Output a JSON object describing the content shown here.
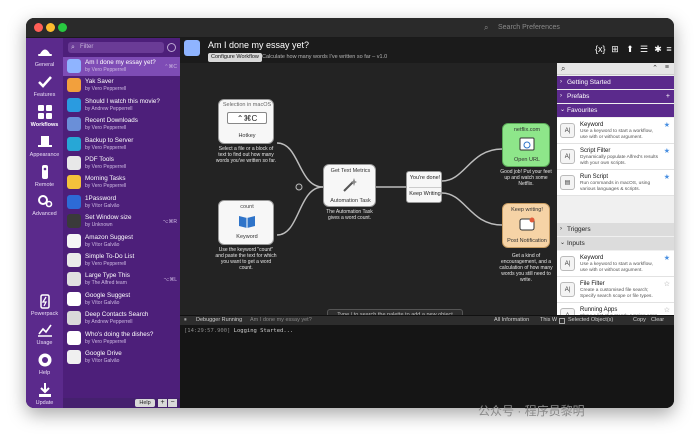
{
  "window": {
    "search_placeholder": "Search Preferences"
  },
  "rail": {
    "items": [
      {
        "label": "General",
        "icon": "alfred-hat-icon"
      },
      {
        "label": "Features",
        "icon": "checkmark-icon"
      },
      {
        "label": "Workflows",
        "icon": "grid-icon"
      },
      {
        "label": "Appearance",
        "icon": "top-hat-icon"
      },
      {
        "label": "Remote",
        "icon": "remote-icon"
      },
      {
        "label": "Advanced",
        "icon": "gears-icon"
      },
      {
        "label": "Powerpack",
        "icon": "battery-icon"
      },
      {
        "label": "Usage",
        "icon": "chart-icon"
      },
      {
        "label": "Help",
        "icon": "lifebuoy-icon"
      },
      {
        "label": "Update",
        "icon": "download-icon"
      }
    ]
  },
  "workflows": {
    "filter_placeholder": "Filter",
    "items": [
      {
        "name": "Am I done my essay yet?",
        "by": "by Vero Pepperrell",
        "hotkey": "⌃⌘C",
        "color": "#8fb4ff"
      },
      {
        "name": "Yak Saver",
        "by": "by Vero Pepperrell",
        "hotkey": "",
        "color": "#f2a03d"
      },
      {
        "name": "Should I watch this movie?",
        "by": "by Andrew Pepperrell",
        "hotkey": "",
        "color": "#2a9be0"
      },
      {
        "name": "Recent Downloads",
        "by": "by Vero Pepperrell",
        "hotkey": "",
        "color": "#6a8fd8"
      },
      {
        "name": "Backup to Server",
        "by": "by Vero Pepperrell",
        "hotkey": "",
        "color": "#27a7d6"
      },
      {
        "name": "PDF Tools",
        "by": "by Vero Pepperrell",
        "hotkey": "",
        "color": "#e8e8e8"
      },
      {
        "name": "Morning Tasks",
        "by": "by Vero Pepperrell",
        "hotkey": "",
        "color": "#f3c23b"
      },
      {
        "name": "1Password",
        "by": "by Vítor Galvão",
        "hotkey": "",
        "color": "#2d6bd6"
      },
      {
        "name": "Set Window size",
        "by": "by Unknown",
        "hotkey": "⌥⌘R",
        "color": "#3a3a3a"
      },
      {
        "name": "Amazon Suggest",
        "by": "by Vítor Galvão",
        "hotkey": "",
        "color": "#f5f5f5"
      },
      {
        "name": "Simple To-Do List",
        "by": "by Vero Pepperrell",
        "hotkey": "",
        "color": "#eaeaea"
      },
      {
        "name": "Large Type This",
        "by": "by The Alfred team",
        "hotkey": "⌥⌘L",
        "color": "#e0e0e0"
      },
      {
        "name": "Google Suggest",
        "by": "by Vítor Galvão",
        "hotkey": "",
        "color": "#ffffff"
      },
      {
        "name": "Deep Contacts Search",
        "by": "by Andrew Pepperrell",
        "hotkey": "",
        "color": "#d9d9d9"
      },
      {
        "name": "Who's doing the dishes?",
        "by": "by Vero Pepperrell",
        "hotkey": "",
        "color": "#ffffff"
      },
      {
        "name": "Google Drive",
        "by": "by Vítor Galvão",
        "hotkey": "",
        "color": "#f0f0f0"
      }
    ],
    "help_label": "Help",
    "add_label": "+",
    "remove_label": "−"
  },
  "header": {
    "title": "Am I done my essay yet?",
    "configure_label": "Configure Workflow",
    "description": "Calculate how many words I've written so far – v1.0",
    "tools": [
      "{x}",
      "⊞",
      "⬆",
      "☰",
      "✱",
      "≡"
    ]
  },
  "canvas": {
    "hotkey_node": {
      "subtitle": "Selection in macOS",
      "keys": "⌃⌘C",
      "title": "Hotkey",
      "desc": "Select a file or a block of text to find out how many words you've written so far."
    },
    "keyword_node": {
      "subtitle": "count",
      "title": "Keyword",
      "desc": "Use the keyword \"count\" and paste the text for which you want to get a word count."
    },
    "task_node": {
      "subtitle": "Get Text Metrics",
      "title": "Automation Task",
      "desc": "The Automation Task gives a word count."
    },
    "filter_node": {
      "line1": "You're done!",
      "line2": "Keep Writing"
    },
    "url_node": {
      "subtitle": "netflix.com",
      "title": "Open URL",
      "desc": "Good job! Put your feet up and watch some Netflix."
    },
    "notify_node": {
      "subtitle": "Keep writing!",
      "title": "Post Notification",
      "desc": "Get a kind of encouragement, and a calculation of how many words you still need to write."
    },
    "palette_hint": "Type / to search the palette to add a new object"
  },
  "debugger": {
    "status": "Debugger Running",
    "workflow": "Am I done my essay yet?",
    "filter": "All Information",
    "scope": "This Workflow",
    "selected": "Selected Object(s)",
    "copy_label": "Copy",
    "clear_label": "Clear",
    "log_time": "[14:29:57.900]",
    "log_text": "Logging Started..."
  },
  "panel": {
    "sections": {
      "getting_started": "Getting Started",
      "prefabs": "Prefabs",
      "favourites": "Favourites",
      "triggers": "Triggers",
      "inputs": "Inputs"
    },
    "favourites": [
      {
        "name": "Keyword",
        "desc": "Use a keyword to start a workflow, use with or without argument.",
        "glyph": "A|"
      },
      {
        "name": "Script Filter",
        "desc": "Dynamically populate Alfred's results with your own scripts.",
        "glyph": "A|"
      },
      {
        "name": "Run Script",
        "desc": "Run commands in macOS, using various languages & scripts.",
        "glyph": "▤"
      }
    ],
    "inputs": [
      {
        "name": "Keyword",
        "desc": "Use a keyword to start a workflow, use with or without argument.",
        "glyph": "A|"
      },
      {
        "name": "File Filter",
        "desc": "Create a customised file search; Specify search scope or file types.",
        "glyph": "A|"
      },
      {
        "name": "Running Apps",
        "desc": "Show a list of currently running apps in macOS.",
        "glyph": "A"
      }
    ]
  },
  "watermark": "公众号 · 程序员黎明",
  "colors": {
    "rail": "#5b2a8c",
    "list": "#4d1f7a",
    "selected": "#7e4cb5",
    "url_node": "#8ee68a",
    "notify_node": "#f6d3a6",
    "star": "#4a90e2"
  }
}
